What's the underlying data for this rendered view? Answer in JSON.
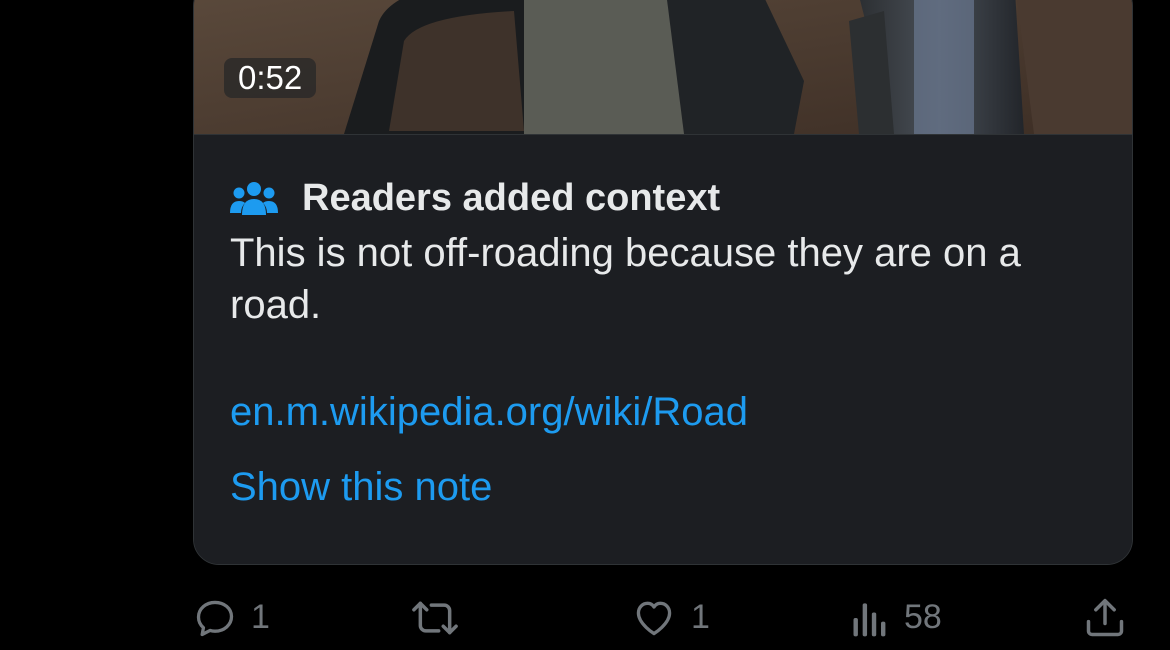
{
  "media": {
    "duration": "0:52"
  },
  "note": {
    "icon": "people-icon",
    "title": "Readers added context",
    "body": "This is not off-roading because they are on a road.",
    "link": "en.m.wikipedia.org/wiki/Road",
    "show_note": "Show this note",
    "accent_color": "#1d9bf0"
  },
  "actions": {
    "reply": {
      "icon": "reply-icon",
      "count": "1"
    },
    "repost": {
      "icon": "repost-icon",
      "count": ""
    },
    "like": {
      "icon": "heart-icon",
      "count": "1"
    },
    "views": {
      "icon": "views-icon",
      "count": "58"
    },
    "share": {
      "icon": "share-icon"
    }
  }
}
